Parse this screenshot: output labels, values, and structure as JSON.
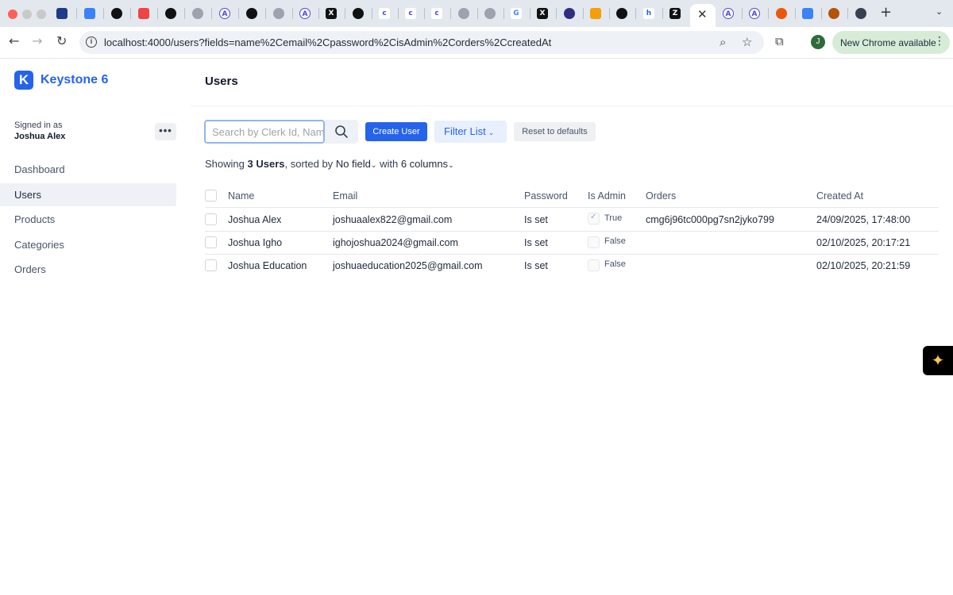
{
  "browser": {
    "url": "localhost:4000/users?fields=name%2Cemail%2Cpassword%2CisAdmin%2Corders%2CcreatedAt",
    "update_label": "New Chrome available",
    "profile_initial": "J",
    "active_tab_close": "✕",
    "new_tab": "+"
  },
  "app": {
    "brand_logo": "K",
    "brand_name": "Keystone 6",
    "page_title": "Users",
    "signed_in_label": "Signed in as",
    "signed_in_user": "Joshua Alex",
    "more_label": "•••"
  },
  "nav": {
    "items": [
      {
        "label": "Dashboard"
      },
      {
        "label": "Users",
        "active": true
      },
      {
        "label": "Products"
      },
      {
        "label": "Categories"
      },
      {
        "label": "Orders"
      }
    ]
  },
  "controls": {
    "search_placeholder": "Search by Clerk Id, Name",
    "create_label": "Create User",
    "filter_label": "Filter List",
    "reset_label": "Reset to defaults"
  },
  "summary": {
    "prefix": "Showing",
    "count": "3 Users",
    "sorted_label": ", sorted by",
    "sort_field": "No field",
    "with_label": "with",
    "columns": "6 columns"
  },
  "table": {
    "headers": [
      "Name",
      "Email",
      "Password",
      "Is Admin",
      "Orders",
      "Created At"
    ],
    "rows": [
      {
        "name": "Joshua Alex",
        "email": "joshuaalex822@gmail.com",
        "password": "Is set",
        "is_admin": true,
        "admin_label": "True",
        "orders": "cmg6j96tc000pg7sn2jyko799",
        "created_at": "24/09/2025, 17:48:00"
      },
      {
        "name": "Joshua Igho",
        "email": "ighojoshua2024@gmail.com",
        "password": "Is set",
        "is_admin": false,
        "admin_label": "False",
        "orders": "",
        "created_at": "02/10/2025, 20:17:21"
      },
      {
        "name": "Joshua Education",
        "email": "joshuaeducation2025@gmail.com",
        "password": "Is set",
        "is_admin": false,
        "admin_label": "False",
        "orders": "",
        "created_at": "02/10/2025, 20:21:59"
      }
    ]
  },
  "colors": {
    "accent": "#2563eb",
    "sidebar_active": "#eef1f5"
  }
}
